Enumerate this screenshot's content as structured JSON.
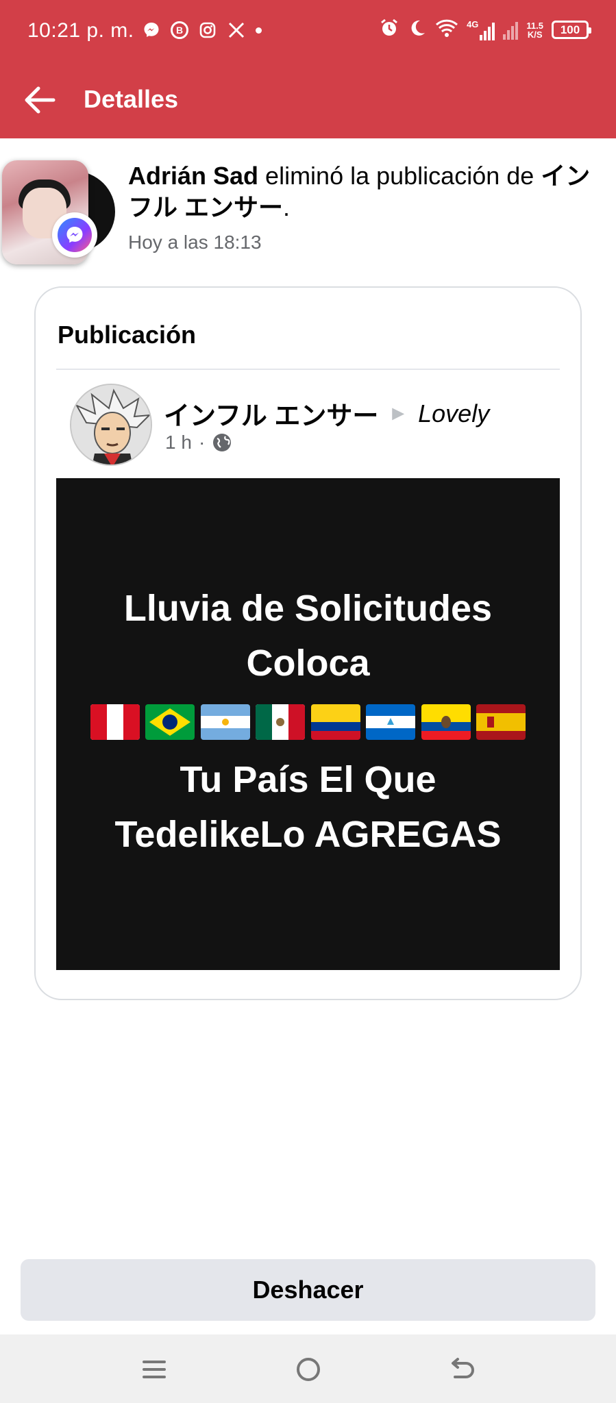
{
  "status_bar": {
    "time": "10:21 p. m.",
    "network_speed_value": "11.5",
    "network_speed_unit": "K/S",
    "network_type": "4G",
    "battery": "100",
    "icons": [
      "messenger-icon",
      "b-app-icon",
      "instagram-icon",
      "x-icon",
      "dot-icon",
      "alarm-icon",
      "moon-icon",
      "wifi-icon",
      "signal-icon",
      "signal-2-icon",
      "battery-icon"
    ]
  },
  "app_bar": {
    "title": "Detalles",
    "back_icon": "arrow-left-icon"
  },
  "notification": {
    "actor": "Adrián Sad",
    "action": " eliminó la publicación de ",
    "target": "インフル エンサー",
    "end": ".",
    "time": "Hoy a las 18:13"
  },
  "post_card": {
    "title": "Publicación",
    "author": "インフル エンサー",
    "arrow": "►",
    "group": "Lovely",
    "time": "1 h",
    "separator": "·",
    "image_lines": [
      "Lluvia de Solicitudes",
      "Coloca",
      "Tu País El Que",
      "TedelikeLo AGREGAS"
    ],
    "flags": [
      "peru-flag",
      "brazil-flag",
      "argentina-flag",
      "mexico-flag",
      "colombia-flag",
      "nicaragua-flag",
      "ecuador-flag",
      "spain-flag"
    ]
  },
  "actions": {
    "undo_label": "Deshacer"
  },
  "nav_bar": {
    "icons": [
      "menu-icon",
      "home-icon",
      "back-icon"
    ]
  },
  "colors": {
    "header_red": "#d23f48",
    "button_gray": "#e4e6eb",
    "image_bg": "#121212",
    "secondary_text": "#65676b"
  }
}
